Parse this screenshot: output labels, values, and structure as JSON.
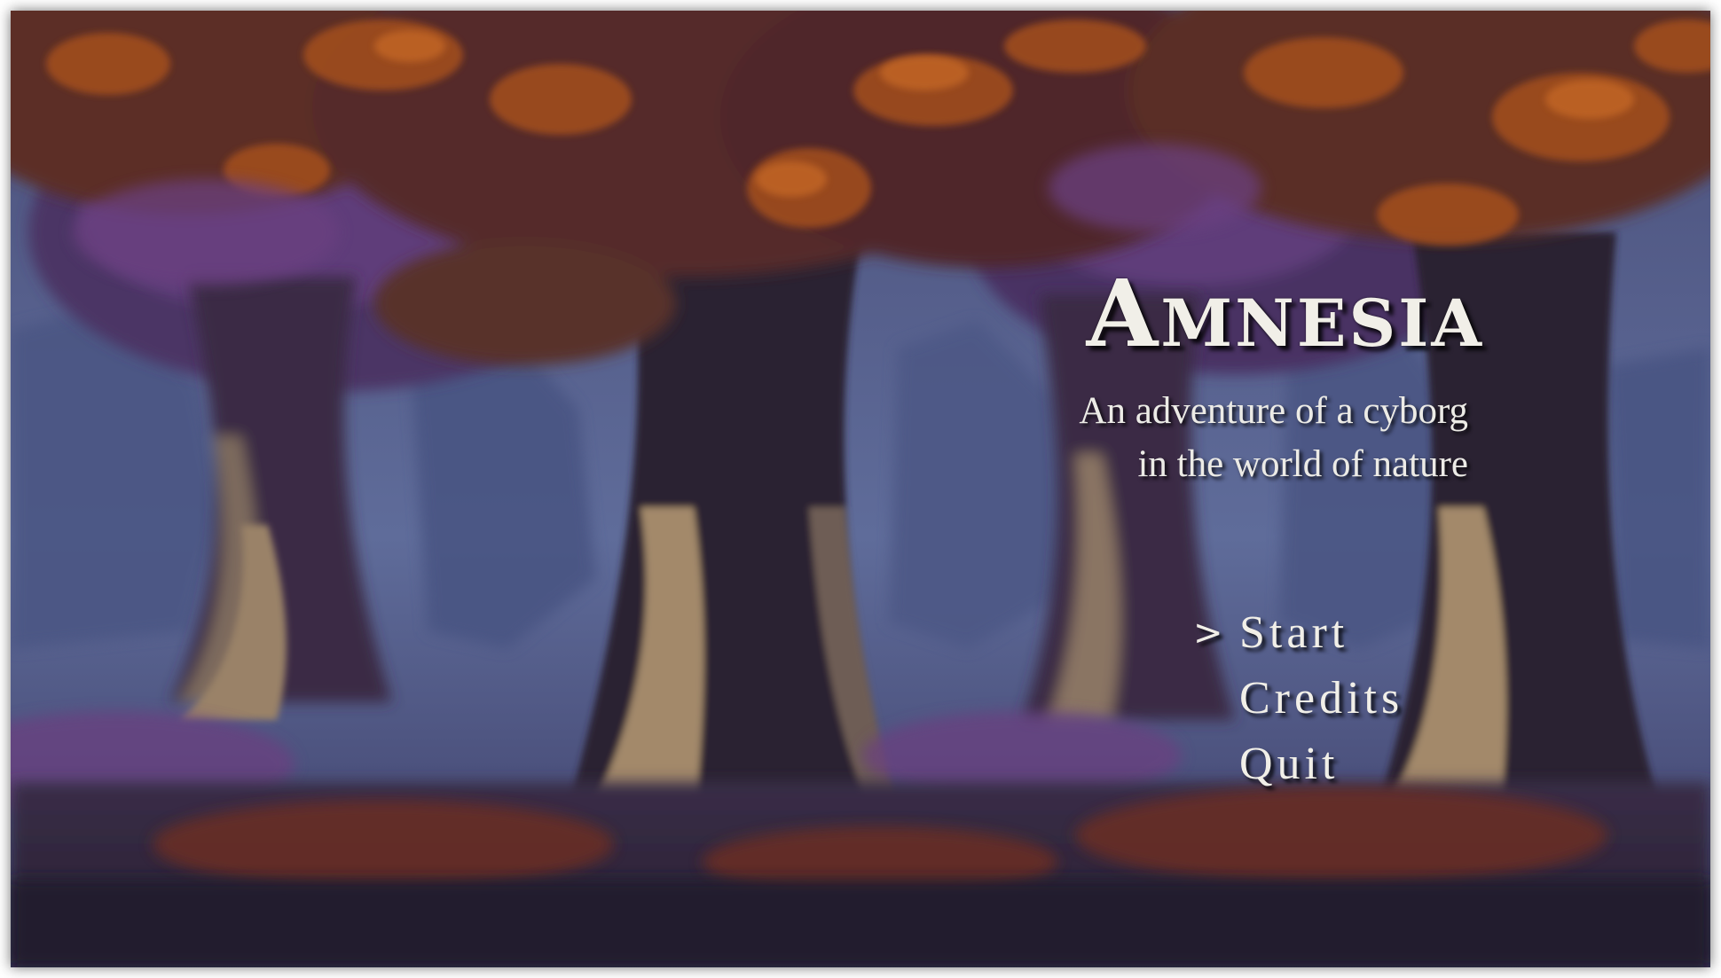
{
  "game": {
    "title": "Amnesia",
    "subtitle_lines": [
      "An adventure of a cyborg",
      "in the world of nature"
    ]
  },
  "menu": {
    "cursor_glyph": ">",
    "selected_index": 0,
    "items": [
      {
        "label": "Start"
      },
      {
        "label": "Credits"
      },
      {
        "label": "Quit"
      }
    ]
  },
  "background": {
    "scene": "pixel-art forest with large trees, orange and purple foliage, blue misty sky",
    "colors": {
      "sky": "#5d6896",
      "dark": "#272134",
      "orange_leaves": "#a4501f",
      "purple_leaves": "#5e3c7a",
      "bark": "#a3896a"
    }
  },
  "colors": {
    "text": "#f1efe8"
  }
}
